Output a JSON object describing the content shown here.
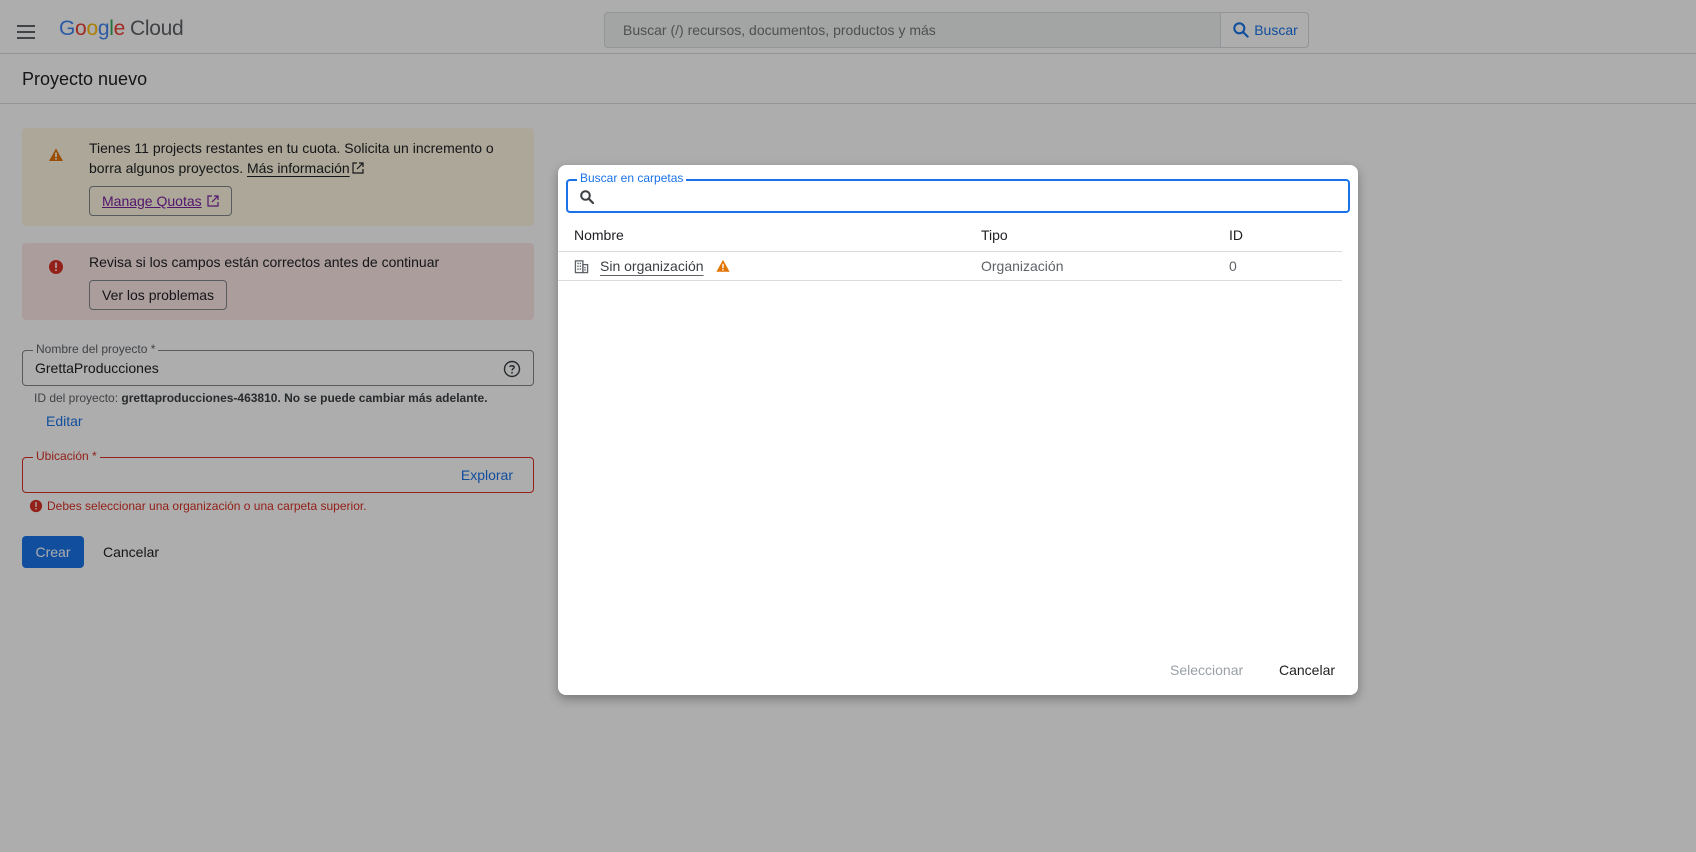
{
  "header": {
    "logo_google": "Google",
    "logo_cloud": "Cloud",
    "search_placeholder": "Buscar (/) recursos, documentos, productos y más",
    "search_button": "Buscar"
  },
  "page": {
    "title": "Proyecto nuevo"
  },
  "quota_banner": {
    "text": "Tienes 11 projects restantes en tu cuota. Solicita un incremento o borra algunos proyectos.",
    "link": "Más información",
    "button": "Manage Quotas"
  },
  "error_banner": {
    "text": "Revisa si los campos están correctos antes de continuar",
    "button": "Ver los problemas"
  },
  "form": {
    "name_label": "Nombre del proyecto *",
    "name_value": "GrettaProducciones",
    "id_hint_prefix": "ID del proyecto:",
    "id_hint_value": "grettaproducciones-463810. No se puede cambiar más adelante.",
    "edit_link": "Editar",
    "location_label": "Ubicación *",
    "explore_link": "Explorar",
    "location_error": "Debes seleccionar una organización o una carpeta superior.",
    "create_button": "Crear",
    "cancel_button": "Cancelar"
  },
  "dialog": {
    "search_label": "Buscar en carpetas",
    "search_value": "",
    "columns": [
      "Nombre",
      "Tipo",
      "ID"
    ],
    "rows": [
      {
        "name": "Sin organización",
        "type": "Organización",
        "id": "0"
      }
    ],
    "select_button": "Seleccionar",
    "cancel_button": "Cancelar"
  },
  "colors": {
    "accent": "#1a73e8",
    "error": "#d93025",
    "warning": "#e37400",
    "warning_bg": "#fef7e0",
    "error_bg": "#fce8e6"
  }
}
